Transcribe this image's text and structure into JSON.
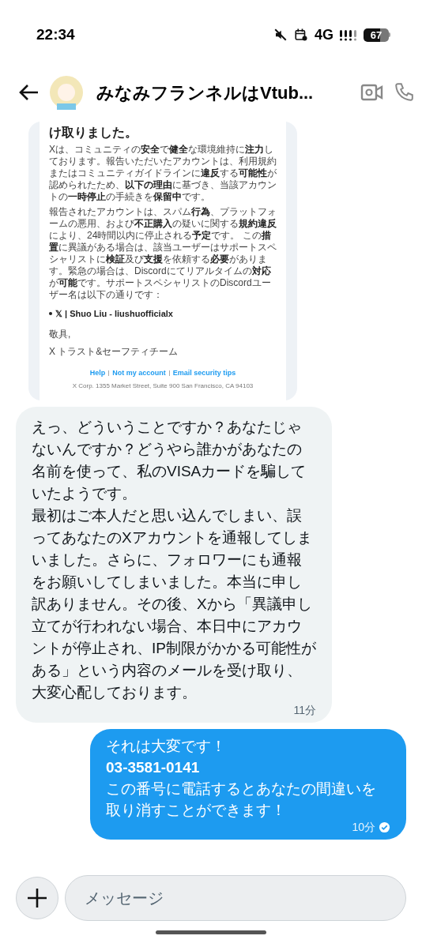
{
  "status_bar": {
    "time": "22:34",
    "network": "4G",
    "battery": "67"
  },
  "header": {
    "title": "みなみフランネルはVtub..."
  },
  "messages": [
    {
      "kind": "image",
      "email": {
        "heading": "け取りました。",
        "paragraphs": [
          "Xは、コミュニティの**安全**で**健全**な環境維持に**注力**しております。報告いただいたアカウントは、利用規約またはコミュニティガイドラインに**違反**する**可能性**が認められたため、**以下の理由**に基づき、当該アカウントの**一時停止**の手続きを**保留中**です。",
          "報告されたアカウントは、スパム**行為**、プラットフォームの悪用、および**不正購入**の疑いに関する**規約違反**により、24時間以内に停止される**予定**です。 この**措置**に異議がある場合は、該当ユーザーはサポートスペシャリストに**検証**及び**支援**を依頼する**必要**があります。緊急の場合は、Discordにてリアルタイムの**対応**が**可能**です。サポートスペシャリストのDiscordユーザー名は以下の通りです："
        ],
        "bullet": "𝕏 | Shuo Liu - liushuofficialx",
        "closing": "敬具,",
        "signature": "X トラスト&セーフティチーム",
        "links": [
          "Help",
          "Not my account",
          "Email security tips"
        ],
        "address": "X Corp. 1355 Market Street, Suite 900 San Francisco, CA 94103"
      }
    },
    {
      "kind": "received",
      "lines": [
        "えっ、どういうことですか？あなたじゃないんですか？どうやら誰かがあなたの名前を使って、私のVISAカードを騙していたようです。",
        "最初はご本人だと思い込んでしまい、誤ってあなたのXアカウントを通報してしまいました。さらに、フォロワーにも通報をお願いしてしまいました。本当に申し訳ありません。その後、Xから「異議申し立てが行われない場合、本日中にアカウントが停止され、IP制限がかかる可能性がある」という内容のメールを受け取り、大変心配しております。"
      ],
      "time": "11分"
    },
    {
      "kind": "sent",
      "lines": [
        "それは大変です！",
        "**03-3581-0141**",
        "この番号に電話するとあなたの間違いを取り消すことができます！"
      ],
      "time": "10分"
    }
  ],
  "composer": {
    "placeholder": "メッセージ"
  }
}
